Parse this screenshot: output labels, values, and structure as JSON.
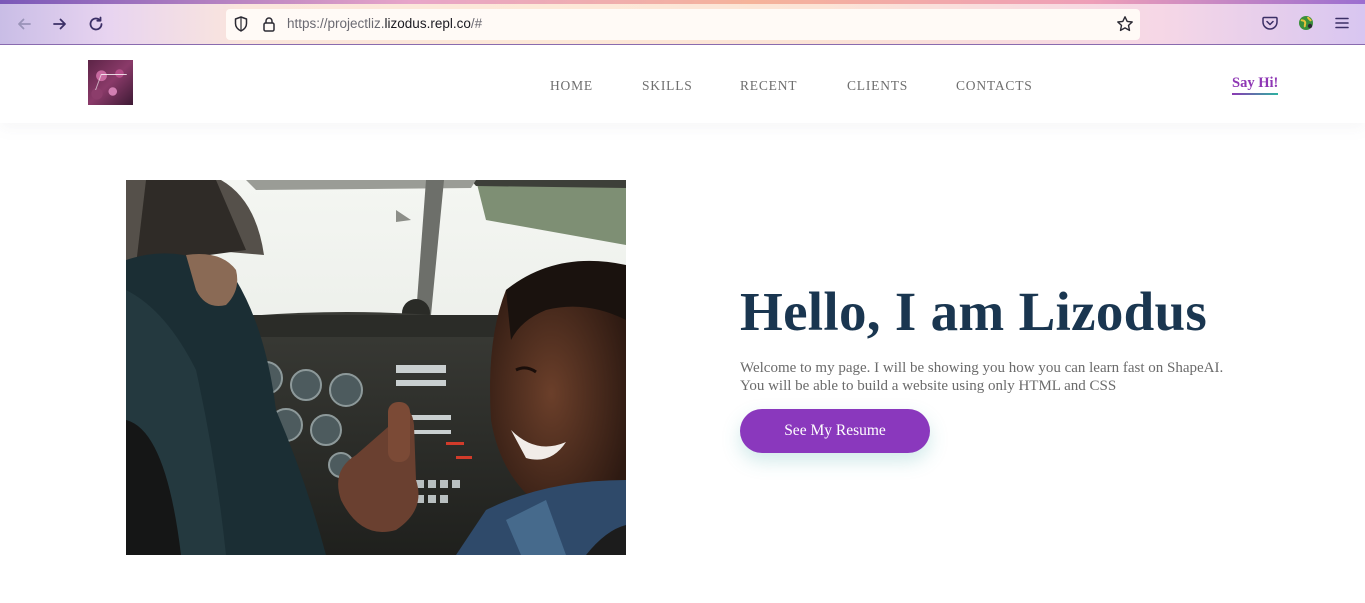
{
  "browser": {
    "url_prefix": "https://projectliz.",
    "url_domain": "lizodus.repl.co",
    "url_suffix": "/#",
    "icons": [
      "back-arrow-icon",
      "forward-arrow-icon",
      "reload-icon",
      "shield-icon",
      "lock-icon",
      "bookmark-star-icon",
      "pocket-icon",
      "extension-globe-icon",
      "hamburger-menu-icon"
    ]
  },
  "header": {
    "nav": [
      {
        "label": "HOME"
      },
      {
        "label": "SKILLS"
      },
      {
        "label": "RECENT"
      },
      {
        "label": "CLIENTS"
      },
      {
        "label": "CONTACTS"
      }
    ],
    "cta": "Say Hi!"
  },
  "hero": {
    "title": "Hello, I am Lizodus",
    "text": "Welcome to my page. I will be showing you how you can learn fast on ShapeAI. You will be able to build a website using only HTML and CSS",
    "button": "See My Resume"
  },
  "colors": {
    "accent": "#8a38bd",
    "title": "#1a3650",
    "text": "#6b6b6b",
    "nav": "#6e6e6e"
  }
}
